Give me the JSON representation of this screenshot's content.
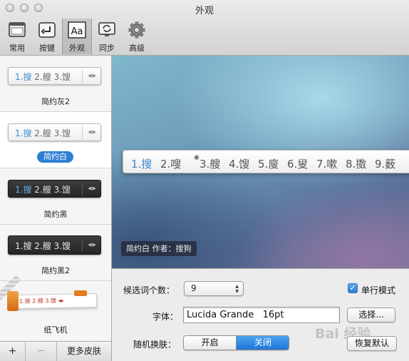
{
  "window": {
    "title": "外观"
  },
  "toolbar": {
    "items": [
      {
        "label": "常用"
      },
      {
        "label": "按键"
      },
      {
        "label": "外观",
        "active": true
      },
      {
        "label": "同步"
      },
      {
        "label": "高级"
      }
    ]
  },
  "skins": [
    {
      "name": "简约灰2",
      "style": "light",
      "candidates": [
        "1.搜",
        "2.艘",
        "3.馊"
      ]
    },
    {
      "name": "简约白",
      "style": "light",
      "selected": true,
      "candidates": [
        "1.搜",
        "2.艘",
        "3.馊"
      ]
    },
    {
      "name": "简约黑",
      "style": "dark",
      "candidates": [
        "1.搜",
        "2.艘",
        "3.馊"
      ]
    },
    {
      "name": "简约黑2",
      "style": "dark",
      "candidates": [
        "1.搜",
        "2.艘",
        "3.馊"
      ]
    },
    {
      "name": "纸飞机",
      "style": "paper",
      "candidates": [
        "1.搜",
        "2.艘",
        "3.馊"
      ]
    }
  ],
  "sidebar_footer": {
    "add": "+",
    "remove": "−",
    "more": "更多皮肤"
  },
  "preview": {
    "candidates": [
      "1.搜",
      "2.嗖",
      "3.艘",
      "4.馊",
      "5.廋",
      "6.叟",
      "7.嗽",
      "8.擞",
      "9.薮"
    ],
    "caption": "简约白  作者：搜狗"
  },
  "settings": {
    "candidate_count_label": "候选词个数：",
    "candidate_count_value": "9",
    "single_line_label": "单行模式",
    "single_line_checked": true,
    "font_label": "字体：",
    "font_value": "Lucida Grande   16pt",
    "choose_button": "选择...",
    "random_skin_label": "随机换肤：",
    "random_on": "开启",
    "random_off": "关闭",
    "random_selected": "关闭",
    "restore_button": "恢复默认"
  },
  "watermark": "Bai 经验",
  "colors": {
    "accent": "#2d7fd1",
    "highlight_text": "#3a87d0"
  }
}
